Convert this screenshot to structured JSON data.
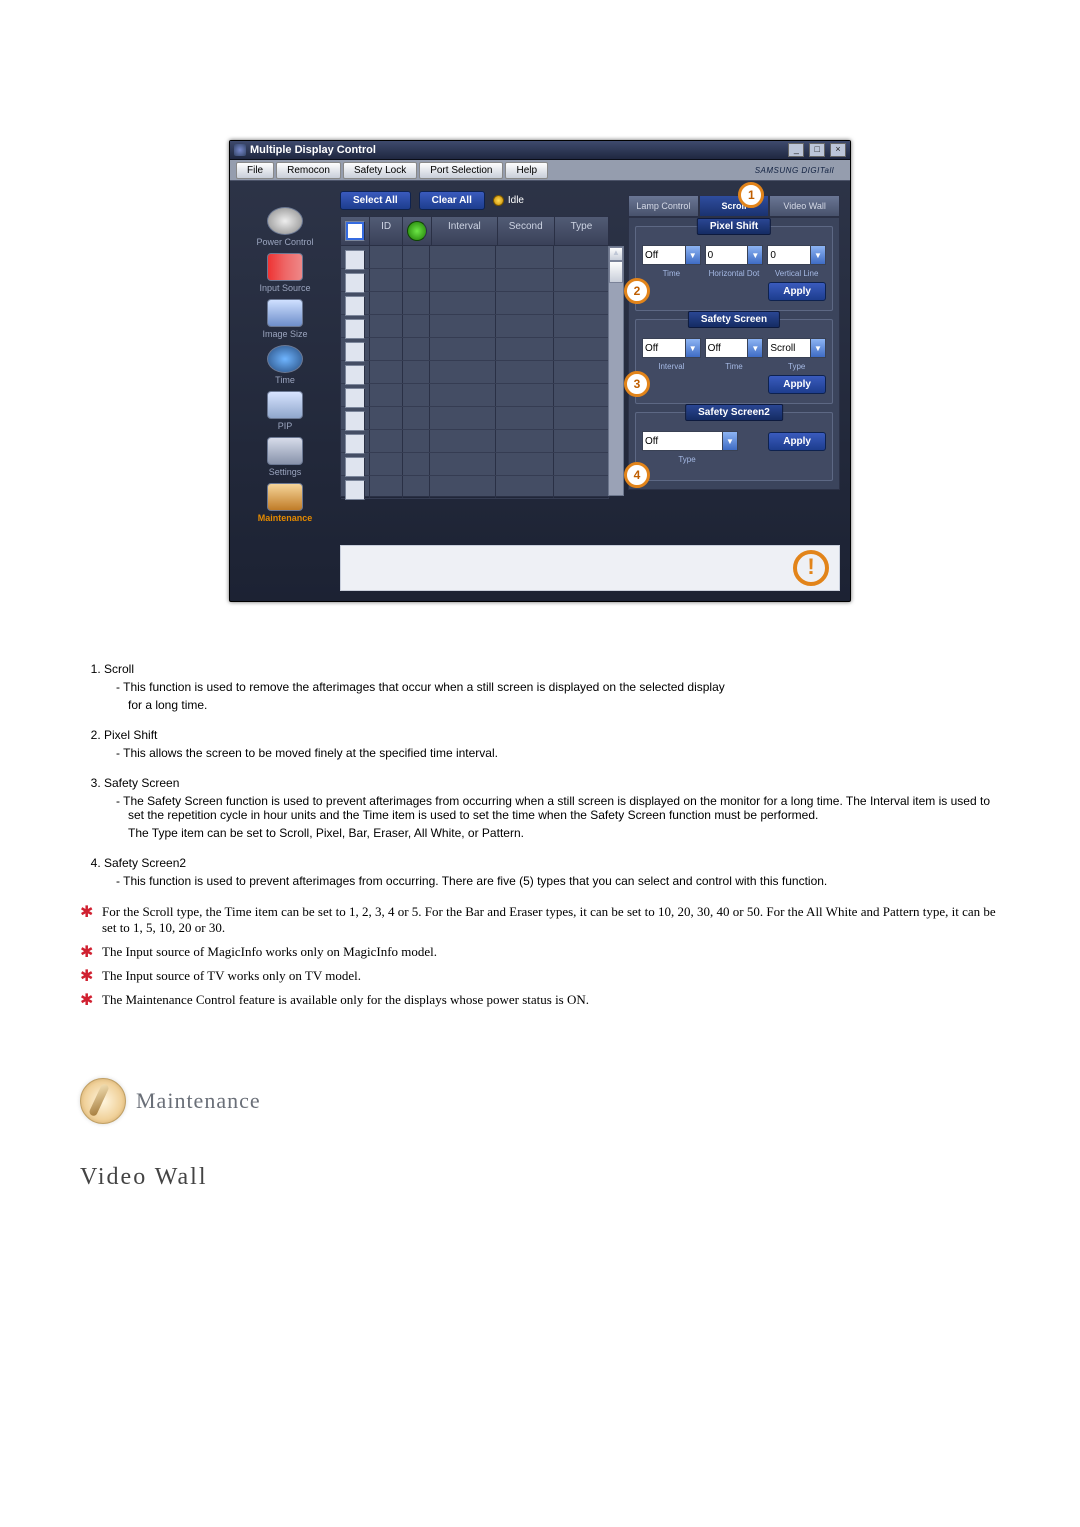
{
  "window": {
    "title": "Multiple Display Control",
    "brand": "SAMSUNG DIGITall"
  },
  "menus": [
    "File",
    "Remocon",
    "Safety Lock",
    "Port Selection",
    "Help"
  ],
  "sidebar": [
    {
      "label": "Power Control"
    },
    {
      "label": "Input Source"
    },
    {
      "label": "Image Size"
    },
    {
      "label": "Time"
    },
    {
      "label": "PIP"
    },
    {
      "label": "Settings"
    },
    {
      "label": "Maintenance"
    }
  ],
  "toolbar": {
    "select_all": "Select All",
    "clear_all": "Clear All",
    "idle": "Idle"
  },
  "grid": {
    "headers": {
      "chk": "",
      "id": "ID",
      "st": "",
      "interval": "Interval",
      "second": "Second",
      "type": "Type"
    },
    "row_count": 11
  },
  "tabs": [
    "Lamp Control",
    "Scroll",
    "Video Wall"
  ],
  "badges": {
    "tab": "1",
    "g2": "2",
    "g3": "3",
    "g4": "4"
  },
  "pixel_shift": {
    "title": "Pixel Shift",
    "time": "Off",
    "hd": "0",
    "vl": "0",
    "labels": {
      "time": "Time",
      "hd": "Horizontal Dot",
      "vl": "Vertical Line"
    },
    "apply": "Apply"
  },
  "safety_screen": {
    "title": "Safety Screen",
    "interval": "Off",
    "time": "Off",
    "type": "Scroll",
    "labels": {
      "interval": "Interval",
      "time": "Time",
      "type": "Type"
    },
    "apply": "Apply"
  },
  "safety_screen2": {
    "title": "Safety Screen2",
    "type": "Off",
    "labels": {
      "type": "Type"
    },
    "apply": "Apply"
  },
  "doc": {
    "items": [
      {
        "title": "Scroll",
        "lines": [
          "This function is used to remove the afterimages that occur when a still screen is displayed on the selected display",
          "for a long time."
        ]
      },
      {
        "title": "Pixel Shift",
        "lines": [
          "This allows the screen to be moved finely at the specified time interval."
        ]
      },
      {
        "title": "Safety Screen",
        "lines": [
          "The Safety Screen function is used to prevent afterimages from occurring when a still screen is displayed on the monitor for a long time.  The Interval item is used to set the repetition cycle in hour units and the Time item is used to set the time when the Safety Screen function must be performed.",
          "The Type item can be set to Scroll, Pixel, Bar, Eraser, All White, or Pattern."
        ]
      },
      {
        "title": "Safety Screen2",
        "lines": [
          "This function is used to prevent afterimages from occurring. There are five (5) types that you can select and control with this function."
        ]
      }
    ],
    "notes": [
      "For the Scroll type, the Time item can be set to 1, 2, 3, 4 or 5. For the Bar and Eraser types, it can be set to 10, 20, 30, 40 or 50. For the All White and Pattern type, it can be set to 1, 5, 10, 20 or 30.",
      "The Input source of MagicInfo works only on MagicInfo model.",
      "The Input source of TV works only on TV model.",
      "The Maintenance Control feature is available only for the displays whose power status is ON."
    ],
    "section_title": "Maintenance",
    "subheading": "Video Wall"
  }
}
